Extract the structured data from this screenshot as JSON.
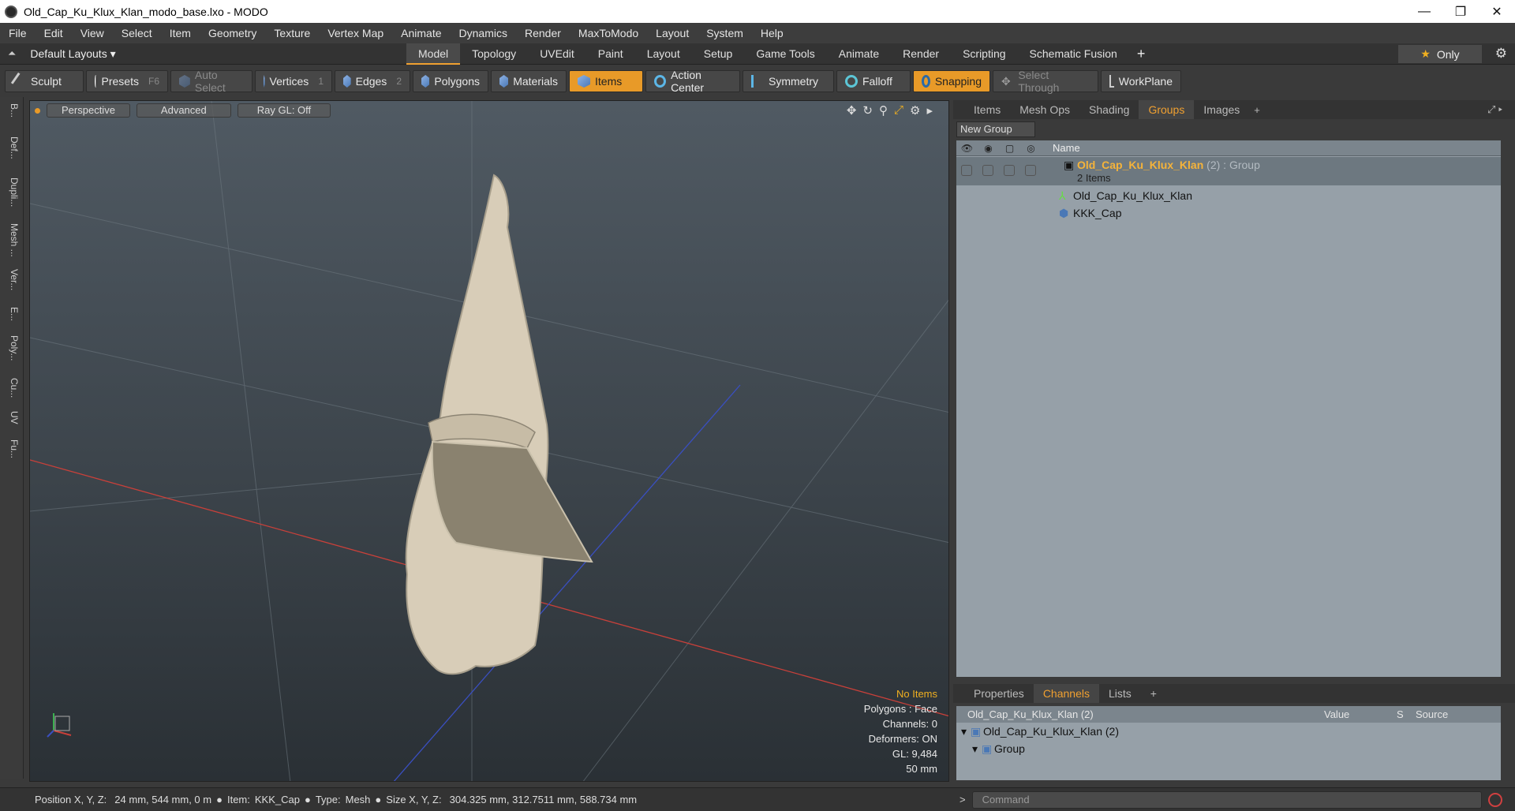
{
  "window": {
    "title": "Old_Cap_Ku_Klux_Klan_modo_base.lxo - MODO",
    "controls": [
      "—",
      "❐",
      "✕"
    ]
  },
  "menu": [
    "File",
    "Edit",
    "View",
    "Select",
    "Item",
    "Geometry",
    "Texture",
    "Vertex Map",
    "Animate",
    "Dynamics",
    "Render",
    "MaxToModo",
    "Layout",
    "System",
    "Help"
  ],
  "layout_selector": "Default Layouts ▾",
  "tabs": [
    "Model",
    "Topology",
    "UVEdit",
    "Paint",
    "Layout",
    "Setup",
    "Game Tools",
    "Animate",
    "Render",
    "Scripting",
    "Schematic Fusion"
  ],
  "active_tab": "Model",
  "only_label": "Only",
  "toolbar": {
    "sculpt": "Sculpt",
    "presets": "Presets",
    "presets_key": "F6",
    "auto_select": "Auto Select",
    "vertices": "Vertices",
    "vertices_count": "1",
    "edges": "Edges",
    "edges_count": "2",
    "polygons": "Polygons",
    "materials": "Materials",
    "items": "Items",
    "action_center": "Action Center",
    "symmetry": "Symmetry",
    "falloff": "Falloff",
    "snapping": "Snapping",
    "select_through": "Select Through",
    "workplane": "WorkPlane"
  },
  "left_tabs": [
    "B...",
    "Def...",
    "Dupli...",
    "Mesh ...",
    "Ver...",
    "E...",
    "Poly...",
    "Cu...",
    "UV",
    "Fu..."
  ],
  "viewport": {
    "view": "Perspective",
    "mode": "Advanced",
    "raygl": "Ray GL: Off",
    "stats": {
      "items": "No Items",
      "polygons": "Polygons : Face",
      "channels": "Channels: 0",
      "deformers": "Deformers: ON",
      "gl": "GL: 9,484",
      "scale": "50 mm"
    }
  },
  "right_panel": {
    "tabs": [
      "Items",
      "Mesh Ops",
      "Shading",
      "Groups",
      "Images"
    ],
    "active_tab": "Groups",
    "new_group": "New Group",
    "name_header": "Name",
    "group": {
      "name": "Old_Cap_Ku_Klux_Klan",
      "count": "(2)",
      "type": ": Group",
      "items_label": "2 Items",
      "children": [
        "Old_Cap_Ku_Klux_Klan",
        "KKK_Cap"
      ]
    }
  },
  "bottom_panel": {
    "tabs": [
      "Properties",
      "Channels",
      "Lists"
    ],
    "active_tab": "Channels",
    "headers": {
      "name": "Old_Cap_Ku_Klux_Klan (2)",
      "value": "Value",
      "s": "S",
      "source": "Source"
    },
    "rows": [
      "Old_Cap_Ku_Klux_Klan (2)",
      "Group"
    ]
  },
  "status": {
    "position_label": "Position X, Y, Z:",
    "position_value": "24 mm, 544 mm, 0 m",
    "item_label": "Item:",
    "item_value": "KKK_Cap",
    "type_label": "Type:",
    "type_value": "Mesh",
    "size_label": "Size X, Y, Z:",
    "size_value": "304.325 mm, 312.7511 mm, 588.734 mm"
  },
  "command_placeholder": "Command",
  "colors": {
    "accent": "#e89a28",
    "group_name": "#f5b33a",
    "viewport_bg": "#46505a"
  }
}
